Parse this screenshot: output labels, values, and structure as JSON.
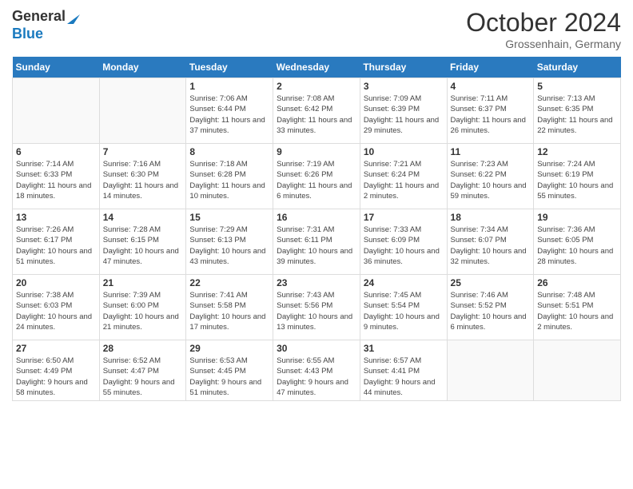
{
  "logo": {
    "line1": "General",
    "line2": "Blue"
  },
  "title": "October 2024",
  "location": "Grossenhain, Germany",
  "days_of_week": [
    "Sunday",
    "Monday",
    "Tuesday",
    "Wednesday",
    "Thursday",
    "Friday",
    "Saturday"
  ],
  "weeks": [
    [
      {
        "day": "",
        "sunrise": "",
        "sunset": "",
        "daylight": ""
      },
      {
        "day": "",
        "sunrise": "",
        "sunset": "",
        "daylight": ""
      },
      {
        "day": "1",
        "sunrise": "Sunrise: 7:06 AM",
        "sunset": "Sunset: 6:44 PM",
        "daylight": "Daylight: 11 hours and 37 minutes."
      },
      {
        "day": "2",
        "sunrise": "Sunrise: 7:08 AM",
        "sunset": "Sunset: 6:42 PM",
        "daylight": "Daylight: 11 hours and 33 minutes."
      },
      {
        "day": "3",
        "sunrise": "Sunrise: 7:09 AM",
        "sunset": "Sunset: 6:39 PM",
        "daylight": "Daylight: 11 hours and 29 minutes."
      },
      {
        "day": "4",
        "sunrise": "Sunrise: 7:11 AM",
        "sunset": "Sunset: 6:37 PM",
        "daylight": "Daylight: 11 hours and 26 minutes."
      },
      {
        "day": "5",
        "sunrise": "Sunrise: 7:13 AM",
        "sunset": "Sunset: 6:35 PM",
        "daylight": "Daylight: 11 hours and 22 minutes."
      }
    ],
    [
      {
        "day": "6",
        "sunrise": "Sunrise: 7:14 AM",
        "sunset": "Sunset: 6:33 PM",
        "daylight": "Daylight: 11 hours and 18 minutes."
      },
      {
        "day": "7",
        "sunrise": "Sunrise: 7:16 AM",
        "sunset": "Sunset: 6:30 PM",
        "daylight": "Daylight: 11 hours and 14 minutes."
      },
      {
        "day": "8",
        "sunrise": "Sunrise: 7:18 AM",
        "sunset": "Sunset: 6:28 PM",
        "daylight": "Daylight: 11 hours and 10 minutes."
      },
      {
        "day": "9",
        "sunrise": "Sunrise: 7:19 AM",
        "sunset": "Sunset: 6:26 PM",
        "daylight": "Daylight: 11 hours and 6 minutes."
      },
      {
        "day": "10",
        "sunrise": "Sunrise: 7:21 AM",
        "sunset": "Sunset: 6:24 PM",
        "daylight": "Daylight: 11 hours and 2 minutes."
      },
      {
        "day": "11",
        "sunrise": "Sunrise: 7:23 AM",
        "sunset": "Sunset: 6:22 PM",
        "daylight": "Daylight: 10 hours and 59 minutes."
      },
      {
        "day": "12",
        "sunrise": "Sunrise: 7:24 AM",
        "sunset": "Sunset: 6:19 PM",
        "daylight": "Daylight: 10 hours and 55 minutes."
      }
    ],
    [
      {
        "day": "13",
        "sunrise": "Sunrise: 7:26 AM",
        "sunset": "Sunset: 6:17 PM",
        "daylight": "Daylight: 10 hours and 51 minutes."
      },
      {
        "day": "14",
        "sunrise": "Sunrise: 7:28 AM",
        "sunset": "Sunset: 6:15 PM",
        "daylight": "Daylight: 10 hours and 47 minutes."
      },
      {
        "day": "15",
        "sunrise": "Sunrise: 7:29 AM",
        "sunset": "Sunset: 6:13 PM",
        "daylight": "Daylight: 10 hours and 43 minutes."
      },
      {
        "day": "16",
        "sunrise": "Sunrise: 7:31 AM",
        "sunset": "Sunset: 6:11 PM",
        "daylight": "Daylight: 10 hours and 39 minutes."
      },
      {
        "day": "17",
        "sunrise": "Sunrise: 7:33 AM",
        "sunset": "Sunset: 6:09 PM",
        "daylight": "Daylight: 10 hours and 36 minutes."
      },
      {
        "day": "18",
        "sunrise": "Sunrise: 7:34 AM",
        "sunset": "Sunset: 6:07 PM",
        "daylight": "Daylight: 10 hours and 32 minutes."
      },
      {
        "day": "19",
        "sunrise": "Sunrise: 7:36 AM",
        "sunset": "Sunset: 6:05 PM",
        "daylight": "Daylight: 10 hours and 28 minutes."
      }
    ],
    [
      {
        "day": "20",
        "sunrise": "Sunrise: 7:38 AM",
        "sunset": "Sunset: 6:03 PM",
        "daylight": "Daylight: 10 hours and 24 minutes."
      },
      {
        "day": "21",
        "sunrise": "Sunrise: 7:39 AM",
        "sunset": "Sunset: 6:00 PM",
        "daylight": "Daylight: 10 hours and 21 minutes."
      },
      {
        "day": "22",
        "sunrise": "Sunrise: 7:41 AM",
        "sunset": "Sunset: 5:58 PM",
        "daylight": "Daylight: 10 hours and 17 minutes."
      },
      {
        "day": "23",
        "sunrise": "Sunrise: 7:43 AM",
        "sunset": "Sunset: 5:56 PM",
        "daylight": "Daylight: 10 hours and 13 minutes."
      },
      {
        "day": "24",
        "sunrise": "Sunrise: 7:45 AM",
        "sunset": "Sunset: 5:54 PM",
        "daylight": "Daylight: 10 hours and 9 minutes."
      },
      {
        "day": "25",
        "sunrise": "Sunrise: 7:46 AM",
        "sunset": "Sunset: 5:52 PM",
        "daylight": "Daylight: 10 hours and 6 minutes."
      },
      {
        "day": "26",
        "sunrise": "Sunrise: 7:48 AM",
        "sunset": "Sunset: 5:51 PM",
        "daylight": "Daylight: 10 hours and 2 minutes."
      }
    ],
    [
      {
        "day": "27",
        "sunrise": "Sunrise: 6:50 AM",
        "sunset": "Sunset: 4:49 PM",
        "daylight": "Daylight: 9 hours and 58 minutes."
      },
      {
        "day": "28",
        "sunrise": "Sunrise: 6:52 AM",
        "sunset": "Sunset: 4:47 PM",
        "daylight": "Daylight: 9 hours and 55 minutes."
      },
      {
        "day": "29",
        "sunrise": "Sunrise: 6:53 AM",
        "sunset": "Sunset: 4:45 PM",
        "daylight": "Daylight: 9 hours and 51 minutes."
      },
      {
        "day": "30",
        "sunrise": "Sunrise: 6:55 AM",
        "sunset": "Sunset: 4:43 PM",
        "daylight": "Daylight: 9 hours and 47 minutes."
      },
      {
        "day": "31",
        "sunrise": "Sunrise: 6:57 AM",
        "sunset": "Sunset: 4:41 PM",
        "daylight": "Daylight: 9 hours and 44 minutes."
      },
      {
        "day": "",
        "sunrise": "",
        "sunset": "",
        "daylight": ""
      },
      {
        "day": "",
        "sunrise": "",
        "sunset": "",
        "daylight": ""
      }
    ]
  ]
}
